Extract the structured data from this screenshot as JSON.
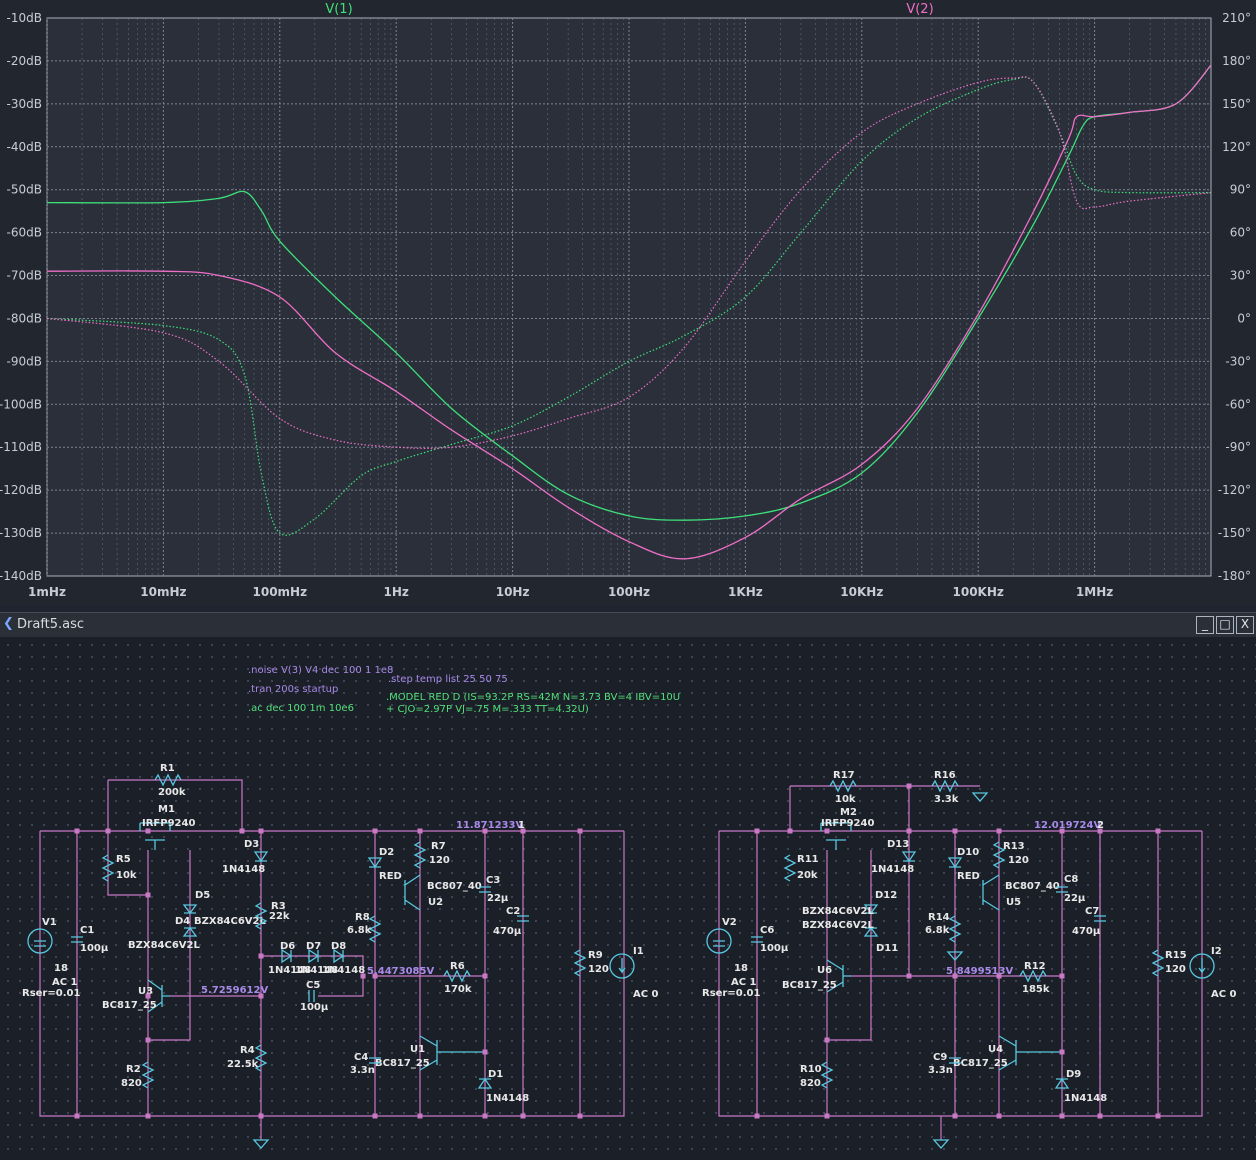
{
  "plot": {
    "trace_labels": [
      {
        "name": "V(1)",
        "color": "#3ee07a"
      },
      {
        "name": "V(2)",
        "color": "#ef6fc7"
      }
    ],
    "y_left_ticks": [
      "-10dB",
      "-20dB",
      "-30dB",
      "-40dB",
      "-50dB",
      "-60dB",
      "-70dB",
      "-80dB",
      "-90dB",
      "-100dB",
      "-110dB",
      "-120dB",
      "-130dB",
      "-140dB"
    ],
    "y_right_ticks": [
      "210°",
      "180°",
      "150°",
      "120°",
      "90°",
      "60°",
      "30°",
      "0°",
      "-30°",
      "-60°",
      "-90°",
      "-120°",
      "-150°",
      "-180°"
    ],
    "x_ticks": [
      "1mHz",
      "10mHz",
      "100mHz",
      "1Hz",
      "10Hz",
      "100Hz",
      "1KHz",
      "10KHz",
      "100KHz",
      "1MHz"
    ],
    "colors": {
      "background": "#22272f",
      "grid": "#7c8494",
      "v1": "#3ee07a",
      "v2": "#ef6fc7"
    }
  },
  "chart_data": {
    "type": "line",
    "xscale": "log",
    "x_unit": "Hz",
    "xlim": [
      0.001,
      10000000
    ],
    "ylim_left": [
      -140,
      -10
    ],
    "y_left_unit": "dB",
    "ylim_right": [
      -180,
      210
    ],
    "y_right_unit": "deg",
    "grid": true,
    "series": [
      {
        "name": "V(1)",
        "axis": "left",
        "style": "solid",
        "color": "#3ee07a",
        "x": [
          0.001,
          0.01,
          0.03,
          0.05,
          0.07,
          0.1,
          0.3,
          1,
          3,
          10,
          30,
          100,
          300,
          1000,
          3000,
          10000,
          30000,
          100000,
          300000,
          600000,
          800000,
          1000000,
          2000000,
          5000000,
          10000000
        ],
        "y": [
          -53,
          -53,
          -52,
          -50.5,
          -55,
          -62,
          -75,
          -88,
          -101,
          -112,
          -121,
          -126,
          -127,
          -126,
          -123,
          -116,
          -102,
          -80,
          -58,
          -42,
          -35,
          -33,
          -32,
          -30,
          -21
        ]
      },
      {
        "name": "V(2)",
        "axis": "left",
        "style": "solid",
        "color": "#ef6fc7",
        "x": [
          0.001,
          0.01,
          0.03,
          0.1,
          0.3,
          1,
          3,
          10,
          30,
          100,
          300,
          1000,
          3000,
          10000,
          30000,
          100000,
          300000,
          600000,
          700000,
          1000000,
          2000000,
          5000000,
          10000000
        ],
        "y": [
          -69,
          -69,
          -70,
          -75,
          -88,
          -97,
          -106,
          -115,
          -124,
          -132,
          -136,
          -131,
          -122,
          -114,
          -101,
          -79,
          -55,
          -38,
          -33,
          -33,
          -32,
          -30,
          -21
        ]
      },
      {
        "name": "V(1) phase",
        "axis": "right",
        "style": "dotted",
        "color": "#3ee07a",
        "x": [
          0.001,
          0.01,
          0.03,
          0.05,
          0.07,
          0.1,
          0.2,
          0.5,
          1,
          3,
          10,
          30,
          100,
          300,
          1000,
          3000,
          10000,
          30000,
          100000,
          200000,
          300000,
          500000,
          700000,
          1000000,
          2000000,
          10000000
        ],
        "y": [
          0,
          -5,
          -15,
          -40,
          -110,
          -150,
          -140,
          -110,
          -100,
          -88,
          -75,
          -55,
          -30,
          -12,
          15,
          60,
          110,
          140,
          160,
          167,
          165,
          130,
          100,
          90,
          88,
          88
        ]
      },
      {
        "name": "V(2) phase",
        "axis": "right",
        "style": "dotted",
        "color": "#ef6fc7",
        "x": [
          0.001,
          0.01,
          0.03,
          0.1,
          0.3,
          1,
          3,
          10,
          30,
          100,
          300,
          1000,
          3000,
          10000,
          30000,
          100000,
          200000,
          300000,
          500000,
          700000,
          1000000,
          2000000,
          10000000
        ],
        "y": [
          0,
          -10,
          -30,
          -70,
          -85,
          -90,
          -90,
          -82,
          -70,
          -55,
          -20,
          40,
          90,
          130,
          150,
          165,
          168,
          165,
          130,
          82,
          78,
          82,
          88
        ]
      }
    ]
  },
  "schematic": {
    "window_title": "Draft5.asc",
    "buttons": {
      "minimize": "_",
      "maximize": "□",
      "close": "X"
    },
    "directives": {
      "noise": ".noise V(3) V4 dec 100 1 1e8",
      "tran": ".tran 200s startup",
      "ac": ".ac dec 100 1m 10e6",
      "step": ".step temp list 25 50 75",
      "model_line1": ".MODEL RED D (IS=93.2P RS=42M N=3.73 BV=4 IBV=10U",
      "model_line2": "+ CJO=2.97P VJ=.75 M=.333 TT=4.32U)"
    },
    "left": {
      "R1": "R1",
      "R1v": "200k",
      "M1": "M1",
      "M1v": "IRFP9240",
      "R5": "R5",
      "R5v": "10k",
      "D5": "D5",
      "D4": "D4",
      "D4v": "BZX84C6V2L",
      "D5v": "BZX84C6V2L",
      "D3": "D3",
      "D3v": "1N4148",
      "R3": "R3",
      "R3v": "22k",
      "D6": "D6",
      "D7": "D7",
      "D8": "D8",
      "D6v": "1N4148",
      "D7v": "1N4148",
      "D8v": "1N4148",
      "V1": "V1",
      "V1v": "18",
      "V1ac": "AC 1",
      "V1rs": "Rser=0.01",
      "C1": "C1",
      "C1v": "100µ",
      "U3": "U3",
      "U3v": "BC817_25",
      "net1": "5.7259612V",
      "C5": "C5",
      "C5v": "100µ",
      "R2": "R2",
      "R2v": "820",
      "R4": "R4",
      "R4v": "22.5k",
      "node_top": "11.871233V",
      "node_id": "1",
      "D2": "D2",
      "D2v": "RED",
      "R7": "R7",
      "R7v": "120",
      "BC807": "BC807_40",
      "U2": "U2",
      "R8": "R8",
      "R8v": "6.8k",
      "C3": "C3",
      "C3v": "22µ",
      "C2": "C2",
      "C2v": "470µ",
      "net2": "5.4473085V",
      "R6": "R6",
      "R6v": "170k",
      "U1": "U1",
      "U1v": "BC817_25",
      "C4": "C4",
      "C4v": "3.3n",
      "D1": "D1",
      "D1v": "1N4148",
      "R9": "R9",
      "R9v": "120",
      "I1": "I1",
      "I1v": "AC 0"
    },
    "right": {
      "R17": "R17",
      "R17v": "10k",
      "R16": "R16",
      "R16v": "3.3k",
      "M2": "M2",
      "M2v": "IRFP9240",
      "R11": "R11",
      "R11v": "20k",
      "D13": "D13",
      "D13v": "1N4148",
      "D12": "D12",
      "D11": "D11",
      "D12v": "BZX84C6V2L",
      "D11v": "BZX84C6V2L",
      "V2": "V2",
      "V2v": "18",
      "V2ac": "AC 1",
      "V2rs": "Rser=0.01",
      "C6": "C6",
      "C6v": "100µ",
      "U6": "U6",
      "U6v": "BC817_25",
      "R10": "R10",
      "R10v": "820",
      "node_top": "12.019724V",
      "node_id": "2",
      "D10": "D10",
      "D10v": "RED",
      "R13": "R13",
      "R13v": "120",
      "BC807": "BC807_40",
      "U5": "U5",
      "C8": "C8",
      "C8v": "22µ",
      "R14": "R14",
      "R14v": "6.8k",
      "C7": "C7",
      "C7v": "470µ",
      "net2": "5.8499513V",
      "R12": "R12",
      "R12v": "185k",
      "U4": "U4",
      "U4v": "BC817_25",
      "C9": "C9",
      "C9v": "3.3n",
      "D9": "D9",
      "D9v": "1N4148",
      "R15": "R15",
      "R15v": "120",
      "I2": "I2",
      "I2v": "AC 0"
    }
  }
}
